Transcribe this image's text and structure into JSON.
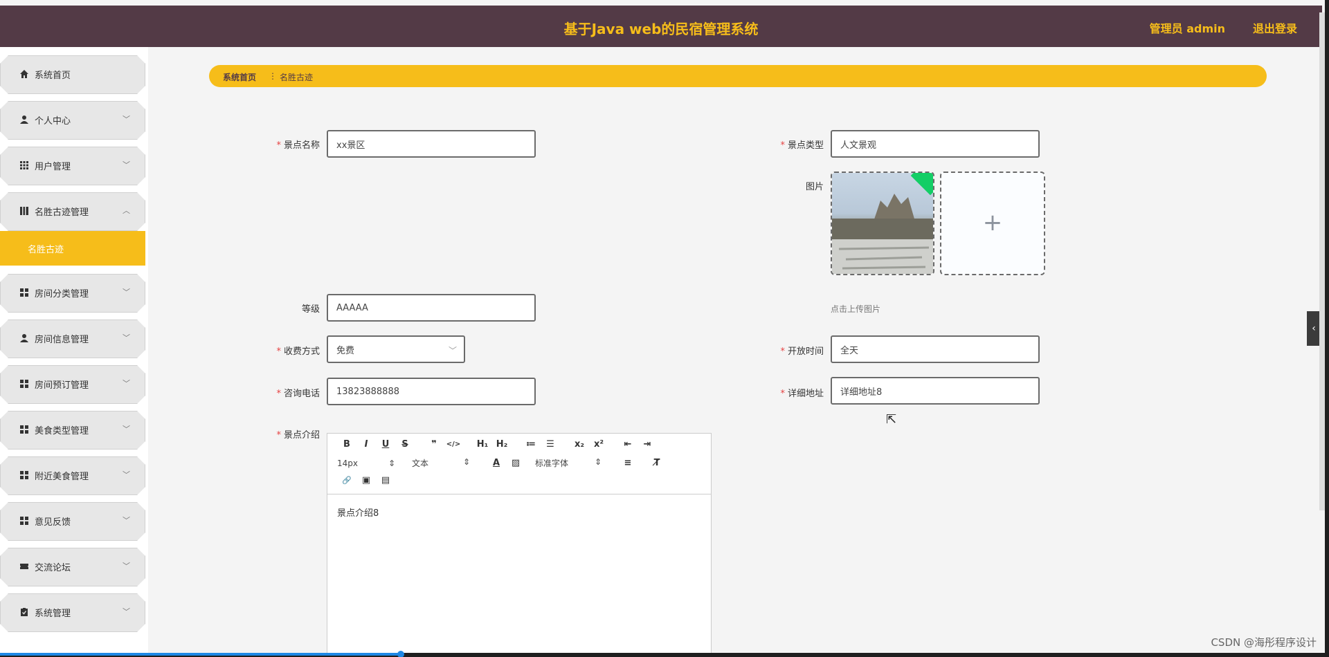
{
  "header": {
    "title": "基于Java web的民宿管理系统",
    "admin": "管理员 admin",
    "logout": "退出登录"
  },
  "sidebar": {
    "items": [
      {
        "label": "系统首页",
        "icon": "home-icon",
        "arrow": ""
      },
      {
        "label": "个人中心",
        "icon": "user-icon",
        "arrow": "﹀"
      },
      {
        "label": "用户管理",
        "icon": "grid-icon",
        "arrow": "﹀"
      },
      {
        "label": "名胜古迹管理",
        "icon": "book-icon",
        "arrow": "︿"
      },
      {
        "label": "房间分类管理",
        "icon": "grid-icon",
        "arrow": "﹀"
      },
      {
        "label": "房间信息管理",
        "icon": "user-icon",
        "arrow": "﹀"
      },
      {
        "label": "房间预订管理",
        "icon": "grid-icon",
        "arrow": "﹀"
      },
      {
        "label": "美食类型管理",
        "icon": "grid-icon",
        "arrow": "﹀"
      },
      {
        "label": "附近美食管理",
        "icon": "grid-icon",
        "arrow": "﹀"
      },
      {
        "label": "意见反馈",
        "icon": "grid-icon",
        "arrow": "﹀"
      },
      {
        "label": "交流论坛",
        "icon": "ticket-icon",
        "arrow": "﹀"
      },
      {
        "label": "系统管理",
        "icon": "clipboard-icon",
        "arrow": "﹀"
      }
    ],
    "active_sub": "名胜古迹"
  },
  "breadcrumb": {
    "home": "系统首页",
    "sep": "⋮",
    "current": "名胜古迹"
  },
  "form": {
    "name": {
      "label": "景点名称",
      "value": "xx景区"
    },
    "type": {
      "label": "景点类型",
      "value": "人文景观"
    },
    "image": {
      "label": "图片",
      "tip": "点击上传图片",
      "add": "+"
    },
    "level": {
      "label": "等级",
      "value": "AAAAA"
    },
    "fee": {
      "label": "收费方式",
      "value": "免费"
    },
    "open": {
      "label": "开放时间",
      "value": "全天"
    },
    "phone": {
      "label": "咨询电话",
      "value": "13823888888"
    },
    "address": {
      "label": "详细地址",
      "value": "详细地址8"
    },
    "intro": {
      "label": "景点介绍",
      "content": "景点介绍8"
    }
  },
  "editor": {
    "row1": [
      "B",
      "I",
      "U",
      "S",
      "❞",
      "</>",
      "H₁",
      "H₂",
      "≔",
      "☰",
      "x₂",
      "x²",
      "⇤",
      "⇥"
    ],
    "size": "14px",
    "format": "文本",
    "font": "标准字体",
    "picker_arrow": "⇕",
    "row2_tail": [
      "A",
      "▨",
      "≡",
      "T̸"
    ],
    "row3": [
      "🔗",
      "▣",
      "▤"
    ]
  },
  "side_tab": "‹",
  "watermark": "CSDN @海彤程序设计"
}
